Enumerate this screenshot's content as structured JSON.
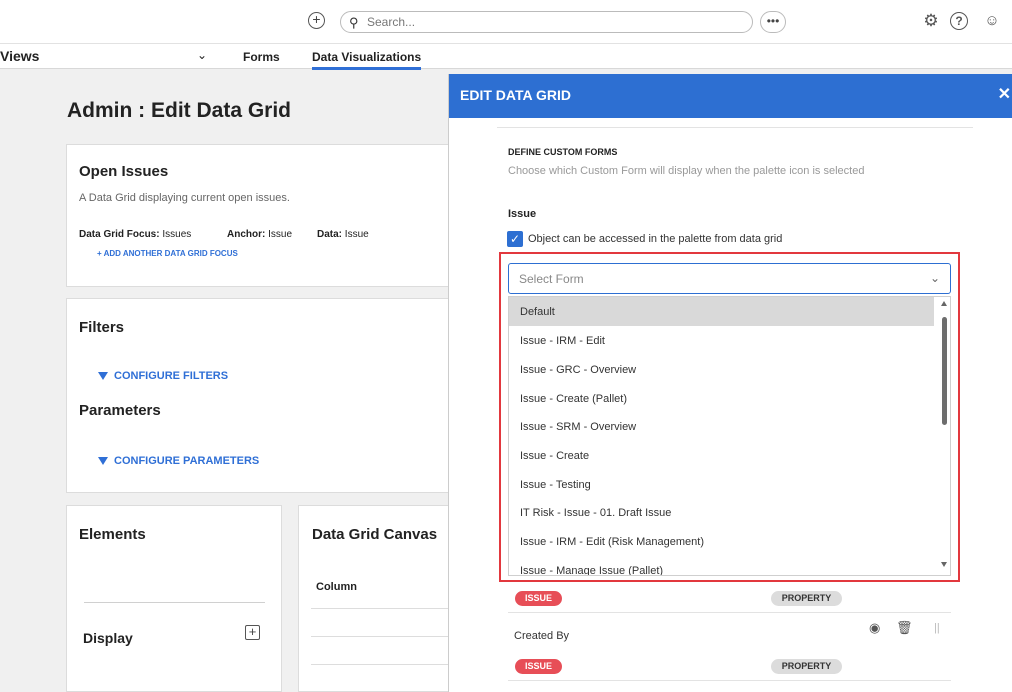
{
  "topbar": {
    "add_icon": "plus-circle-icon",
    "search_placeholder": "Search...",
    "more_label": "•••",
    "settings_icon": "gear-icon",
    "help_label": "?",
    "user_icon": "user-icon"
  },
  "nav": {
    "views_label": "Views",
    "tabs": [
      "Forms",
      "Data Visualizations"
    ]
  },
  "main": {
    "title": "Admin : Edit Data Grid",
    "open_issues": {
      "title": "Open Issues",
      "description": "A Data Grid displaying current open issues.",
      "focus_label": "Data Grid Focus:",
      "focus_value": "Issues",
      "anchor_label": "Anchor:",
      "anchor_value": "Issue",
      "data_label": "Data:",
      "data_value": "Issue",
      "add_focus": "+ ADD ANOTHER DATA GRID FOCUS"
    },
    "filters": {
      "title": "Filters",
      "configure": "CONFIGURE FILTERS"
    },
    "parameters": {
      "title": "Parameters",
      "configure": "CONFIGURE PARAMETERS"
    },
    "elements": {
      "title": "Elements",
      "display": "Display"
    },
    "canvas": {
      "title": "Data Grid Canvas",
      "column": "Column"
    }
  },
  "panel": {
    "title": "EDIT DATA GRID",
    "section_title": "DEFINE CUSTOM FORMS",
    "section_desc": "Choose which Custom Form will display when the palette icon is selected",
    "object_label": "Issue",
    "checkbox_label": "Object can be accessed in the palette from data grid",
    "select_placeholder": "Select Form",
    "options": [
      "Default",
      "Issue - IRM - Edit",
      "Issue - GRC - Overview",
      "Issue - Create (Pallet)",
      "Issue - SRM - Overview",
      "Issue - Create",
      "Issue - Testing",
      "IT Risk - Issue - 01. Draft Issue",
      "Issue - IRM - Edit (Risk Management)",
      "Issue - Manage Issue (Pallet)"
    ],
    "rows": [
      {
        "label": "",
        "badge1": "ISSUE",
        "badge2": "PROPERTY"
      },
      {
        "label": "Created By",
        "badge1": "ISSUE",
        "badge2": "PROPERTY"
      }
    ]
  },
  "colors": {
    "accent": "#2d6fd2",
    "highlight": "#e2383e",
    "issue_badge": "#e74e57"
  }
}
